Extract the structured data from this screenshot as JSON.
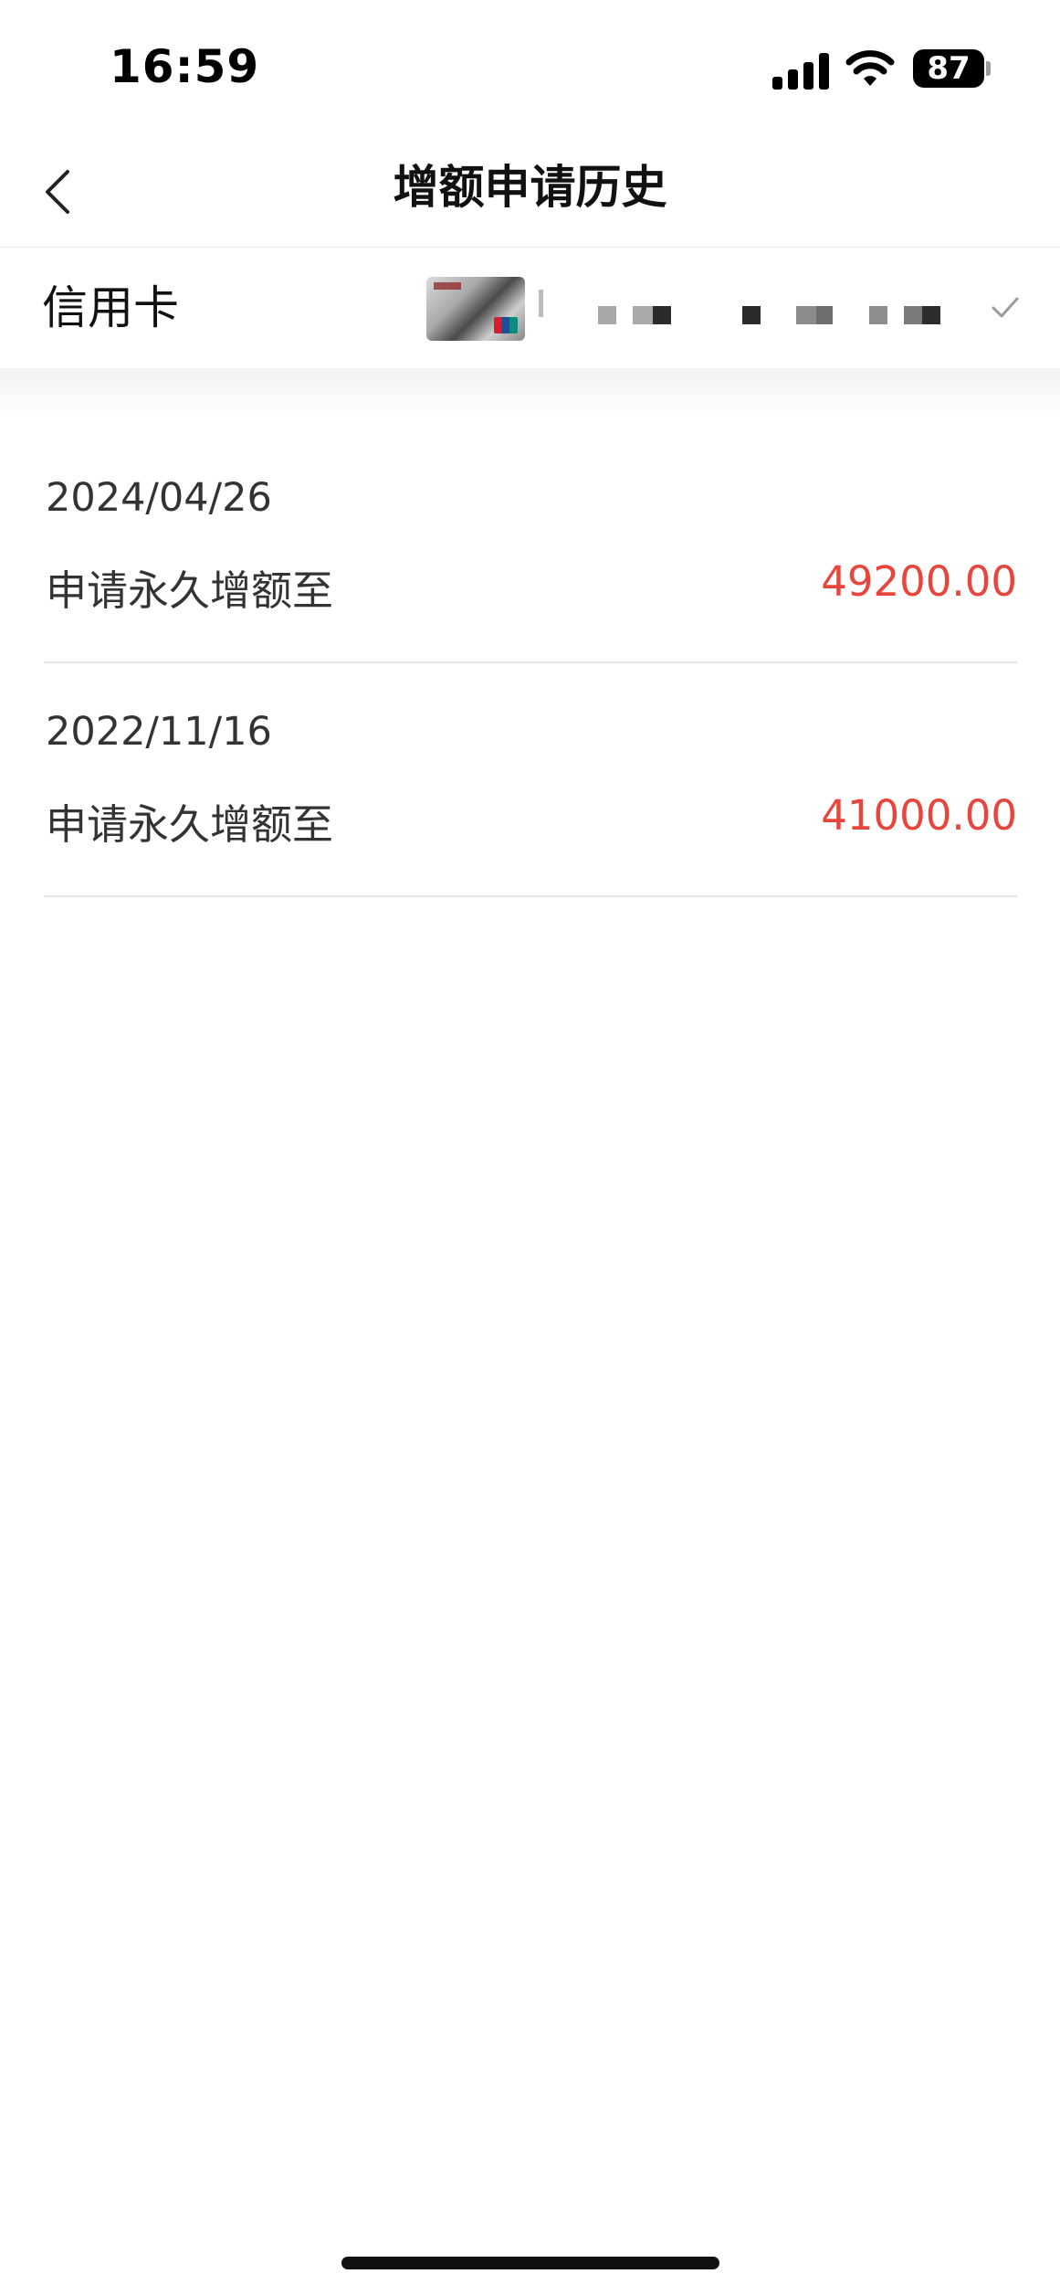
{
  "status_bar": {
    "time": "16:59",
    "battery": "87"
  },
  "nav": {
    "title": "增额申请历史"
  },
  "card_selector": {
    "label": "信用卡"
  },
  "history": [
    {
      "date": "2024/04/26",
      "description": "申请永久增额至",
      "amount": "49200.00"
    },
    {
      "date": "2022/11/16",
      "description": "申请永久增额至",
      "amount": "41000.00"
    }
  ],
  "colors": {
    "amount": "#e8453c",
    "divider": "#e7e7e7"
  }
}
